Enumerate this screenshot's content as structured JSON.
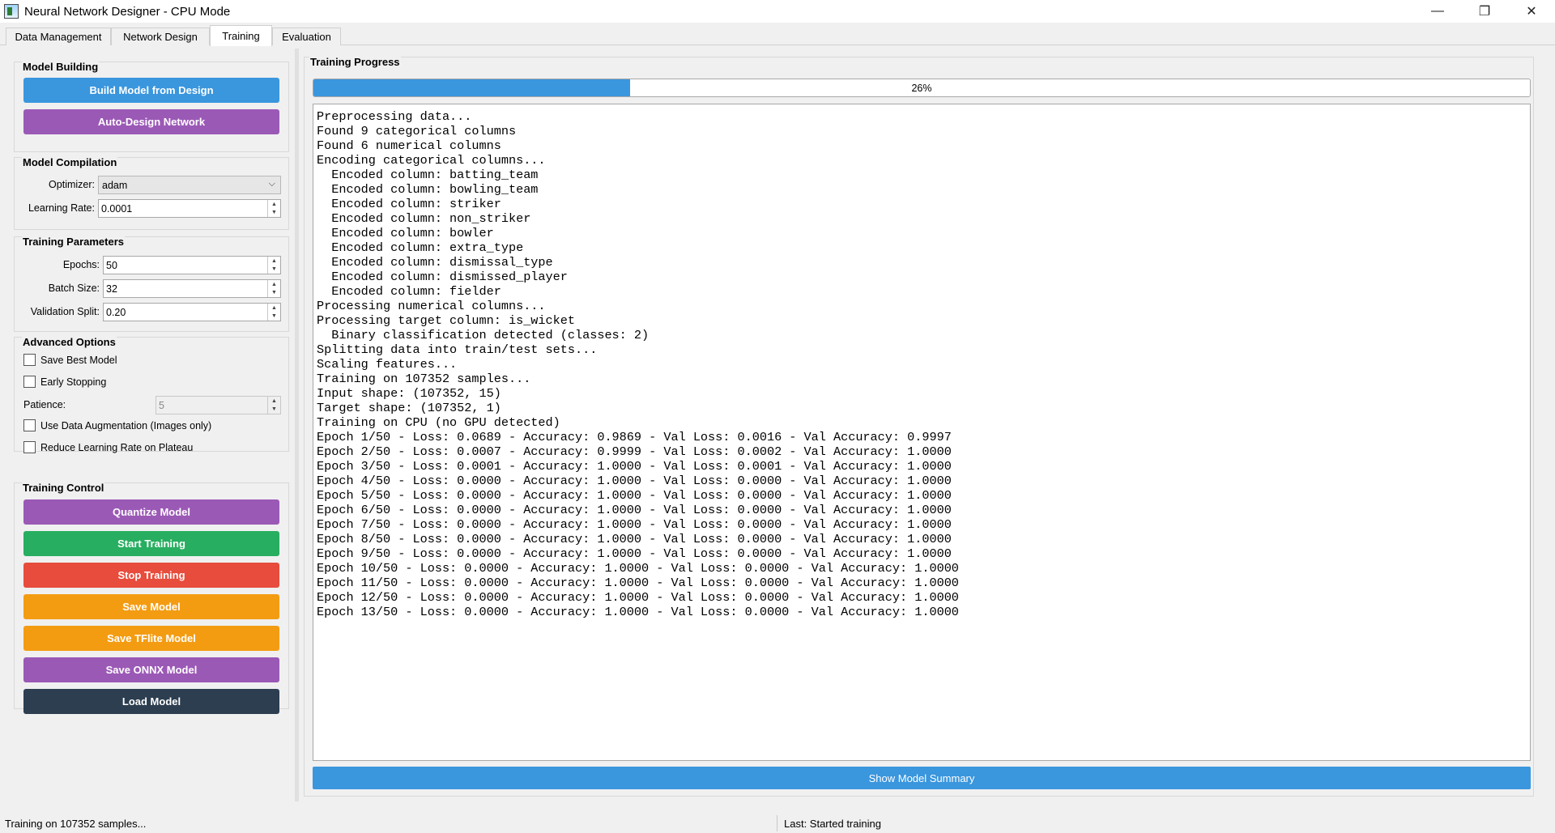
{
  "window": {
    "title": "Neural Network Designer - CPU Mode",
    "controls": {
      "minimize": "—",
      "maximize": "❐",
      "close": "✕"
    }
  },
  "tabs": [
    {
      "label": "Data Management"
    },
    {
      "label": "Network Design"
    },
    {
      "label": "Training",
      "active": true
    },
    {
      "label": "Evaluation"
    }
  ],
  "model_building": {
    "title": "Model Building",
    "build_label": "Build Model from Design",
    "auto_design_label": "Auto-Design Network"
  },
  "model_compilation": {
    "title": "Model Compilation",
    "optimizer_label": "Optimizer:",
    "optimizer_value": "adam",
    "learning_rate_label": "Learning Rate:",
    "learning_rate_value": "0.0001"
  },
  "training_parameters": {
    "title": "Training Parameters",
    "epochs_label": "Epochs:",
    "epochs_value": "50",
    "batch_size_label": "Batch Size:",
    "batch_size_value": "32",
    "validation_split_label": "Validation Split:",
    "validation_split_value": "0.20"
  },
  "advanced_options": {
    "title": "Advanced Options",
    "save_best_label": "Save Best Model",
    "early_stopping_label": "Early Stopping",
    "patience_label": "Patience:",
    "patience_value": "5",
    "augmentation_label": "Use Data Augmentation (Images only)",
    "reduce_lr_label": "Reduce Learning Rate on Plateau"
  },
  "training_control": {
    "title": "Training Control",
    "quantize_label": "Quantize Model",
    "start_label": "Start Training",
    "stop_label": "Stop Training",
    "save_label": "Save Model",
    "save_tflite_label": "Save TFlite Model",
    "save_onnx_label": "Save ONNX Model",
    "load_label": "Load Model"
  },
  "colors": {
    "blue": "#3a96dd",
    "purple": "#9b59b6",
    "green": "#27ae60",
    "red": "#e74c3c",
    "orange": "#f39c12",
    "dark": "#2c3e50"
  },
  "training_progress": {
    "title": "Training Progress",
    "progress_percent": 26,
    "progress_text": "26%",
    "log_lines": [
      "Preprocessing data...",
      "Found 9 categorical columns",
      "Found 6 numerical columns",
      "Encoding categorical columns...",
      "  Encoded column: batting_team",
      "  Encoded column: bowling_team",
      "  Encoded column: striker",
      "  Encoded column: non_striker",
      "  Encoded column: bowler",
      "  Encoded column: extra_type",
      "  Encoded column: dismissal_type",
      "  Encoded column: dismissed_player",
      "  Encoded column: fielder",
      "Processing numerical columns...",
      "Processing target column: is_wicket",
      "  Binary classification detected (classes: 2)",
      "Splitting data into train/test sets...",
      "Scaling features...",
      "Training on 107352 samples...",
      "Input shape: (107352, 15)",
      "Target shape: (107352, 1)",
      "Training on CPU (no GPU detected)",
      "Epoch 1/50 - Loss: 0.0689 - Accuracy: 0.9869 - Val Loss: 0.0016 - Val Accuracy: 0.9997",
      "Epoch 2/50 - Loss: 0.0007 - Accuracy: 0.9999 - Val Loss: 0.0002 - Val Accuracy: 1.0000",
      "Epoch 3/50 - Loss: 0.0001 - Accuracy: 1.0000 - Val Loss: 0.0001 - Val Accuracy: 1.0000",
      "Epoch 4/50 - Loss: 0.0000 - Accuracy: 1.0000 - Val Loss: 0.0000 - Val Accuracy: 1.0000",
      "Epoch 5/50 - Loss: 0.0000 - Accuracy: 1.0000 - Val Loss: 0.0000 - Val Accuracy: 1.0000",
      "Epoch 6/50 - Loss: 0.0000 - Accuracy: 1.0000 - Val Loss: 0.0000 - Val Accuracy: 1.0000",
      "Epoch 7/50 - Loss: 0.0000 - Accuracy: 1.0000 - Val Loss: 0.0000 - Val Accuracy: 1.0000",
      "Epoch 8/50 - Loss: 0.0000 - Accuracy: 1.0000 - Val Loss: 0.0000 - Val Accuracy: 1.0000",
      "Epoch 9/50 - Loss: 0.0000 - Accuracy: 1.0000 - Val Loss: 0.0000 - Val Accuracy: 1.0000",
      "Epoch 10/50 - Loss: 0.0000 - Accuracy: 1.0000 - Val Loss: 0.0000 - Val Accuracy: 1.0000",
      "Epoch 11/50 - Loss: 0.0000 - Accuracy: 1.0000 - Val Loss: 0.0000 - Val Accuracy: 1.0000",
      "Epoch 12/50 - Loss: 0.0000 - Accuracy: 1.0000 - Val Loss: 0.0000 - Val Accuracy: 1.0000",
      "Epoch 13/50 - Loss: 0.0000 - Accuracy: 1.0000 - Val Loss: 0.0000 - Val Accuracy: 1.0000"
    ],
    "summary_label": "Show Model Summary"
  },
  "status": {
    "left": "Training on 107352 samples...",
    "right": "Last: Started training"
  }
}
